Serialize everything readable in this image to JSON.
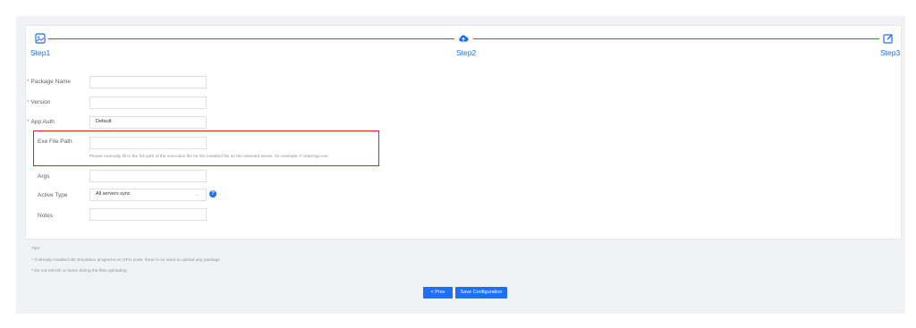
{
  "steps": [
    {
      "label": "Step1",
      "icon": "image-icon"
    },
    {
      "label": "Step2",
      "icon": "cloud-upload-icon"
    },
    {
      "label": "Step3",
      "icon": "edit-icon"
    }
  ],
  "form": {
    "package_name_label": "Package Name",
    "version_label": "Version",
    "app_auth_label": "App Auth",
    "app_auth_value": "Default",
    "exe_path_label": "Exe File Path",
    "exe_path_hint": "Please manually fill in the full path of the execution file for the installed file on the selected server, for example: F:StartApp.exe",
    "args_label": "Args",
    "active_type_label": "Active Type",
    "active_type_value": "All servers sync",
    "notes_label": "Notes",
    "required_mark": "*",
    "help_glyph": "?"
  },
  "tips": {
    "title": "Tips:",
    "line1": "* If already installed 3D simulation programs on GPU node, there is no need to upload any package",
    "line2": "* Do not refresh or leave during the files uploading"
  },
  "buttons": {
    "prev": "< Prev",
    "save": "Save Configuration"
  },
  "colors": {
    "accent": "#1e6ff1",
    "required": "#f56c6c",
    "highlight": "#e31d1c"
  }
}
